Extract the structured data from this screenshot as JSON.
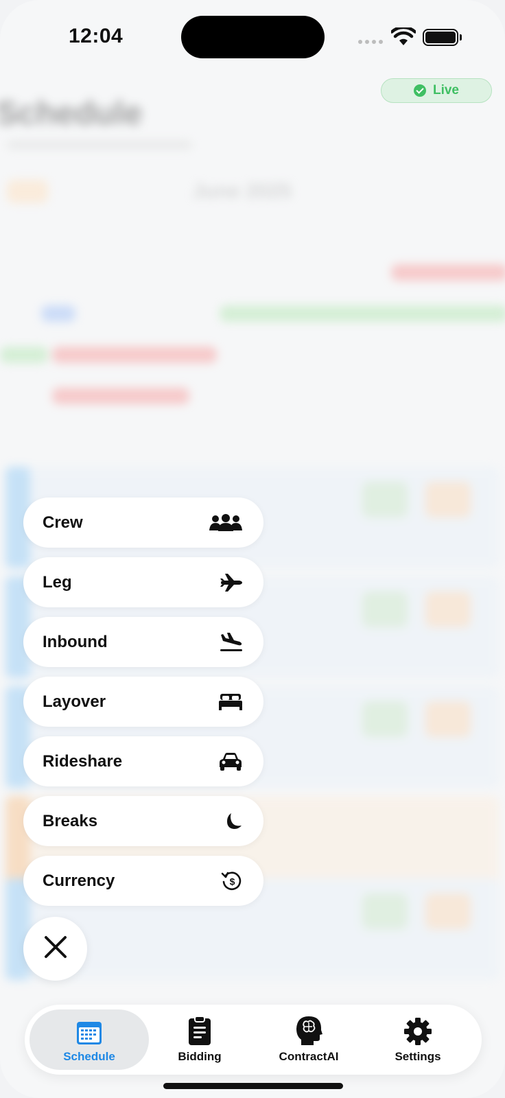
{
  "status_bar": {
    "time": "12:04"
  },
  "header": {
    "title": "Schedule",
    "month": "June 2025"
  },
  "live_badge": {
    "label": "Live",
    "color": "#3fbf63"
  },
  "quick_add_menu": {
    "items": [
      {
        "label": "Crew",
        "icon": "crew-icon"
      },
      {
        "label": "Leg",
        "icon": "airplane-icon"
      },
      {
        "label": "Inbound",
        "icon": "plane-landing-icon"
      },
      {
        "label": "Layover",
        "icon": "bed-icon"
      },
      {
        "label": "Rideshare",
        "icon": "car-icon"
      },
      {
        "label": "Breaks",
        "icon": "moon-icon"
      },
      {
        "label": "Currency",
        "icon": "currency-history-icon"
      }
    ],
    "close_icon": "close-icon"
  },
  "tabbar": {
    "tabs": [
      {
        "label": "Schedule",
        "icon": "calendar-icon",
        "active": true
      },
      {
        "label": "Bidding",
        "icon": "clipboard-icon",
        "active": false
      },
      {
        "label": "ContractAI",
        "icon": "brain-head-icon",
        "active": false
      },
      {
        "label": "Settings",
        "icon": "gear-icon",
        "active": false
      }
    ],
    "active_color": "#1e88e5"
  }
}
